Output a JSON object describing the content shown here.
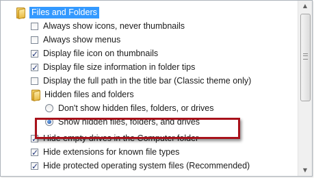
{
  "tree": {
    "root_folder": {
      "label": "Files and Folders",
      "selected": true
    },
    "options": [
      {
        "label": "Always show icons, never thumbnails",
        "checked": false
      },
      {
        "label": "Always show menus",
        "checked": false
      },
      {
        "label": "Display file icon on thumbnails",
        "checked": true
      },
      {
        "label": "Display file size information in folder tips",
        "checked": true
      },
      {
        "label": "Display the full path in the title bar (Classic theme only)",
        "checked": false
      }
    ],
    "hidden_folder": {
      "label": "Hidden files and folders",
      "radios": [
        {
          "label": "Don't show hidden files, folders, or drives",
          "checked": false
        },
        {
          "label": "Show hidden files, folders, and drives",
          "checked": true
        }
      ]
    },
    "more_options": [
      {
        "label": "Hide empty drives in the Computer folder",
        "checked": true
      },
      {
        "label": "Hide extensions for known file types",
        "checked": true
      },
      {
        "label": "Hide protected operating system files (Recommended)",
        "checked": true
      }
    ]
  },
  "scrollbar": {
    "up_icon": "scroll-up-arrow-icon",
    "down_icon": "scroll-down-arrow-icon",
    "grip_icon": "scroll-grip-icon"
  },
  "colors": {
    "selection": "#3399ff",
    "highlight_box": "#a8111a"
  }
}
